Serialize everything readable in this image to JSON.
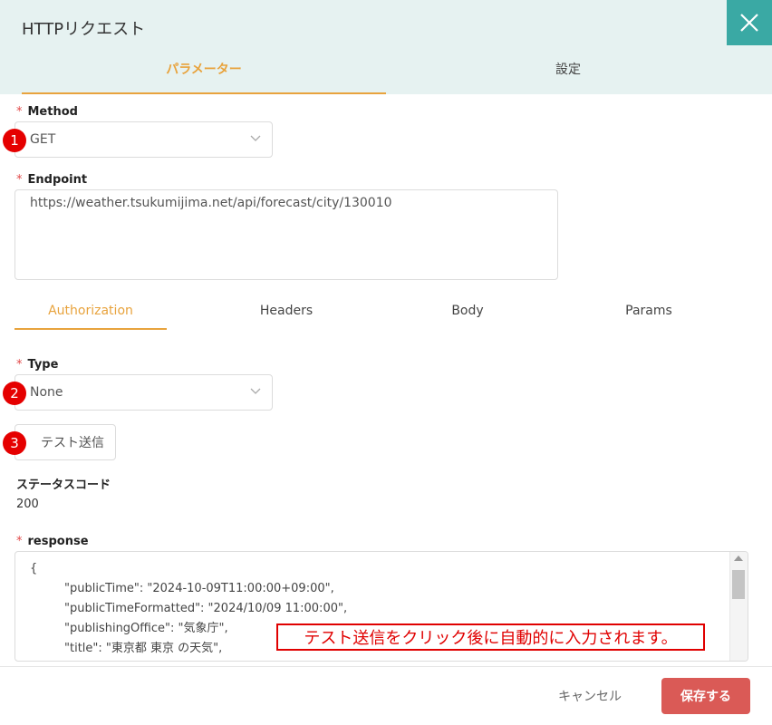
{
  "dialog": {
    "title": "HTTPリクエスト"
  },
  "main_tabs": [
    {
      "label": "パラメーター",
      "active": true
    },
    {
      "label": "設定",
      "active": false
    }
  ],
  "method": {
    "label": "Method",
    "required_mark": "*",
    "value": "GET"
  },
  "endpoint": {
    "label": "Endpoint",
    "required_mark": "*",
    "value": "https://weather.tsukumijima.net/api/forecast/city/130010"
  },
  "sub_tabs": [
    {
      "label": "Authorization",
      "active": true
    },
    {
      "label": "Headers",
      "active": false
    },
    {
      "label": "Body",
      "active": false
    },
    {
      "label": "Params",
      "active": false
    }
  ],
  "type": {
    "label": "Type",
    "required_mark": "*",
    "value": "None"
  },
  "test_button": {
    "label": "テスト送信"
  },
  "status": {
    "label": "ステータスコード",
    "value": "200"
  },
  "response": {
    "label": "response",
    "required_mark": "*",
    "lines": [
      "{",
      "\"publicTime\": \"2024-10-09T11:00:00+09:00\",",
      "\"publicTimeFormatted\": \"2024/10/09 11:00:00\",",
      "\"publishingOffice\": \"気象庁\",",
      "\"title\": \"東京都 東京 の天気\","
    ]
  },
  "badges": [
    "1",
    "2",
    "3"
  ],
  "annotation": {
    "text": "テスト送信をクリック後に自動的に入力されます。"
  },
  "footer": {
    "cancel_label": "キャンセル",
    "save_label": "保存する"
  },
  "colors": {
    "accent": "#e8a33d",
    "header_bg": "#e6f2f1",
    "close_bg": "#3aa9a4",
    "save_bg": "#da5a56",
    "badge": "#e50000",
    "required": "#e24a4a"
  }
}
